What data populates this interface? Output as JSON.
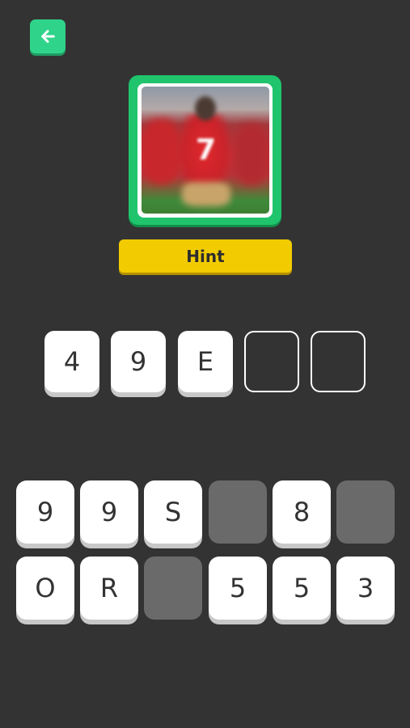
{
  "header": {
    "back_icon": "arrow-left-icon",
    "accent": "#2fd48a"
  },
  "puzzle": {
    "image_description_icon": "player-photo",
    "frame_color": "#1fc46c"
  },
  "hint": {
    "label": "Hint",
    "color": "#f2cb00"
  },
  "answer": {
    "slots": [
      {
        "char": "4",
        "filled": true
      },
      {
        "char": "9",
        "filled": true
      },
      {
        "char": "E",
        "filled": true
      },
      {
        "char": "",
        "filled": false
      },
      {
        "char": "",
        "filled": false
      }
    ]
  },
  "keyboard": {
    "row1": [
      {
        "char": "9",
        "used": false
      },
      {
        "char": "9",
        "used": false
      },
      {
        "char": "S",
        "used": false
      },
      {
        "char": "",
        "used": true
      },
      {
        "char": "8",
        "used": false
      },
      {
        "char": "",
        "used": true
      }
    ],
    "row2": [
      {
        "char": "O",
        "used": false
      },
      {
        "char": "R",
        "used": false
      },
      {
        "char": "",
        "used": true
      },
      {
        "char": "5",
        "used": false
      },
      {
        "char": "5",
        "used": false
      },
      {
        "char": "3",
        "used": false
      }
    ]
  }
}
